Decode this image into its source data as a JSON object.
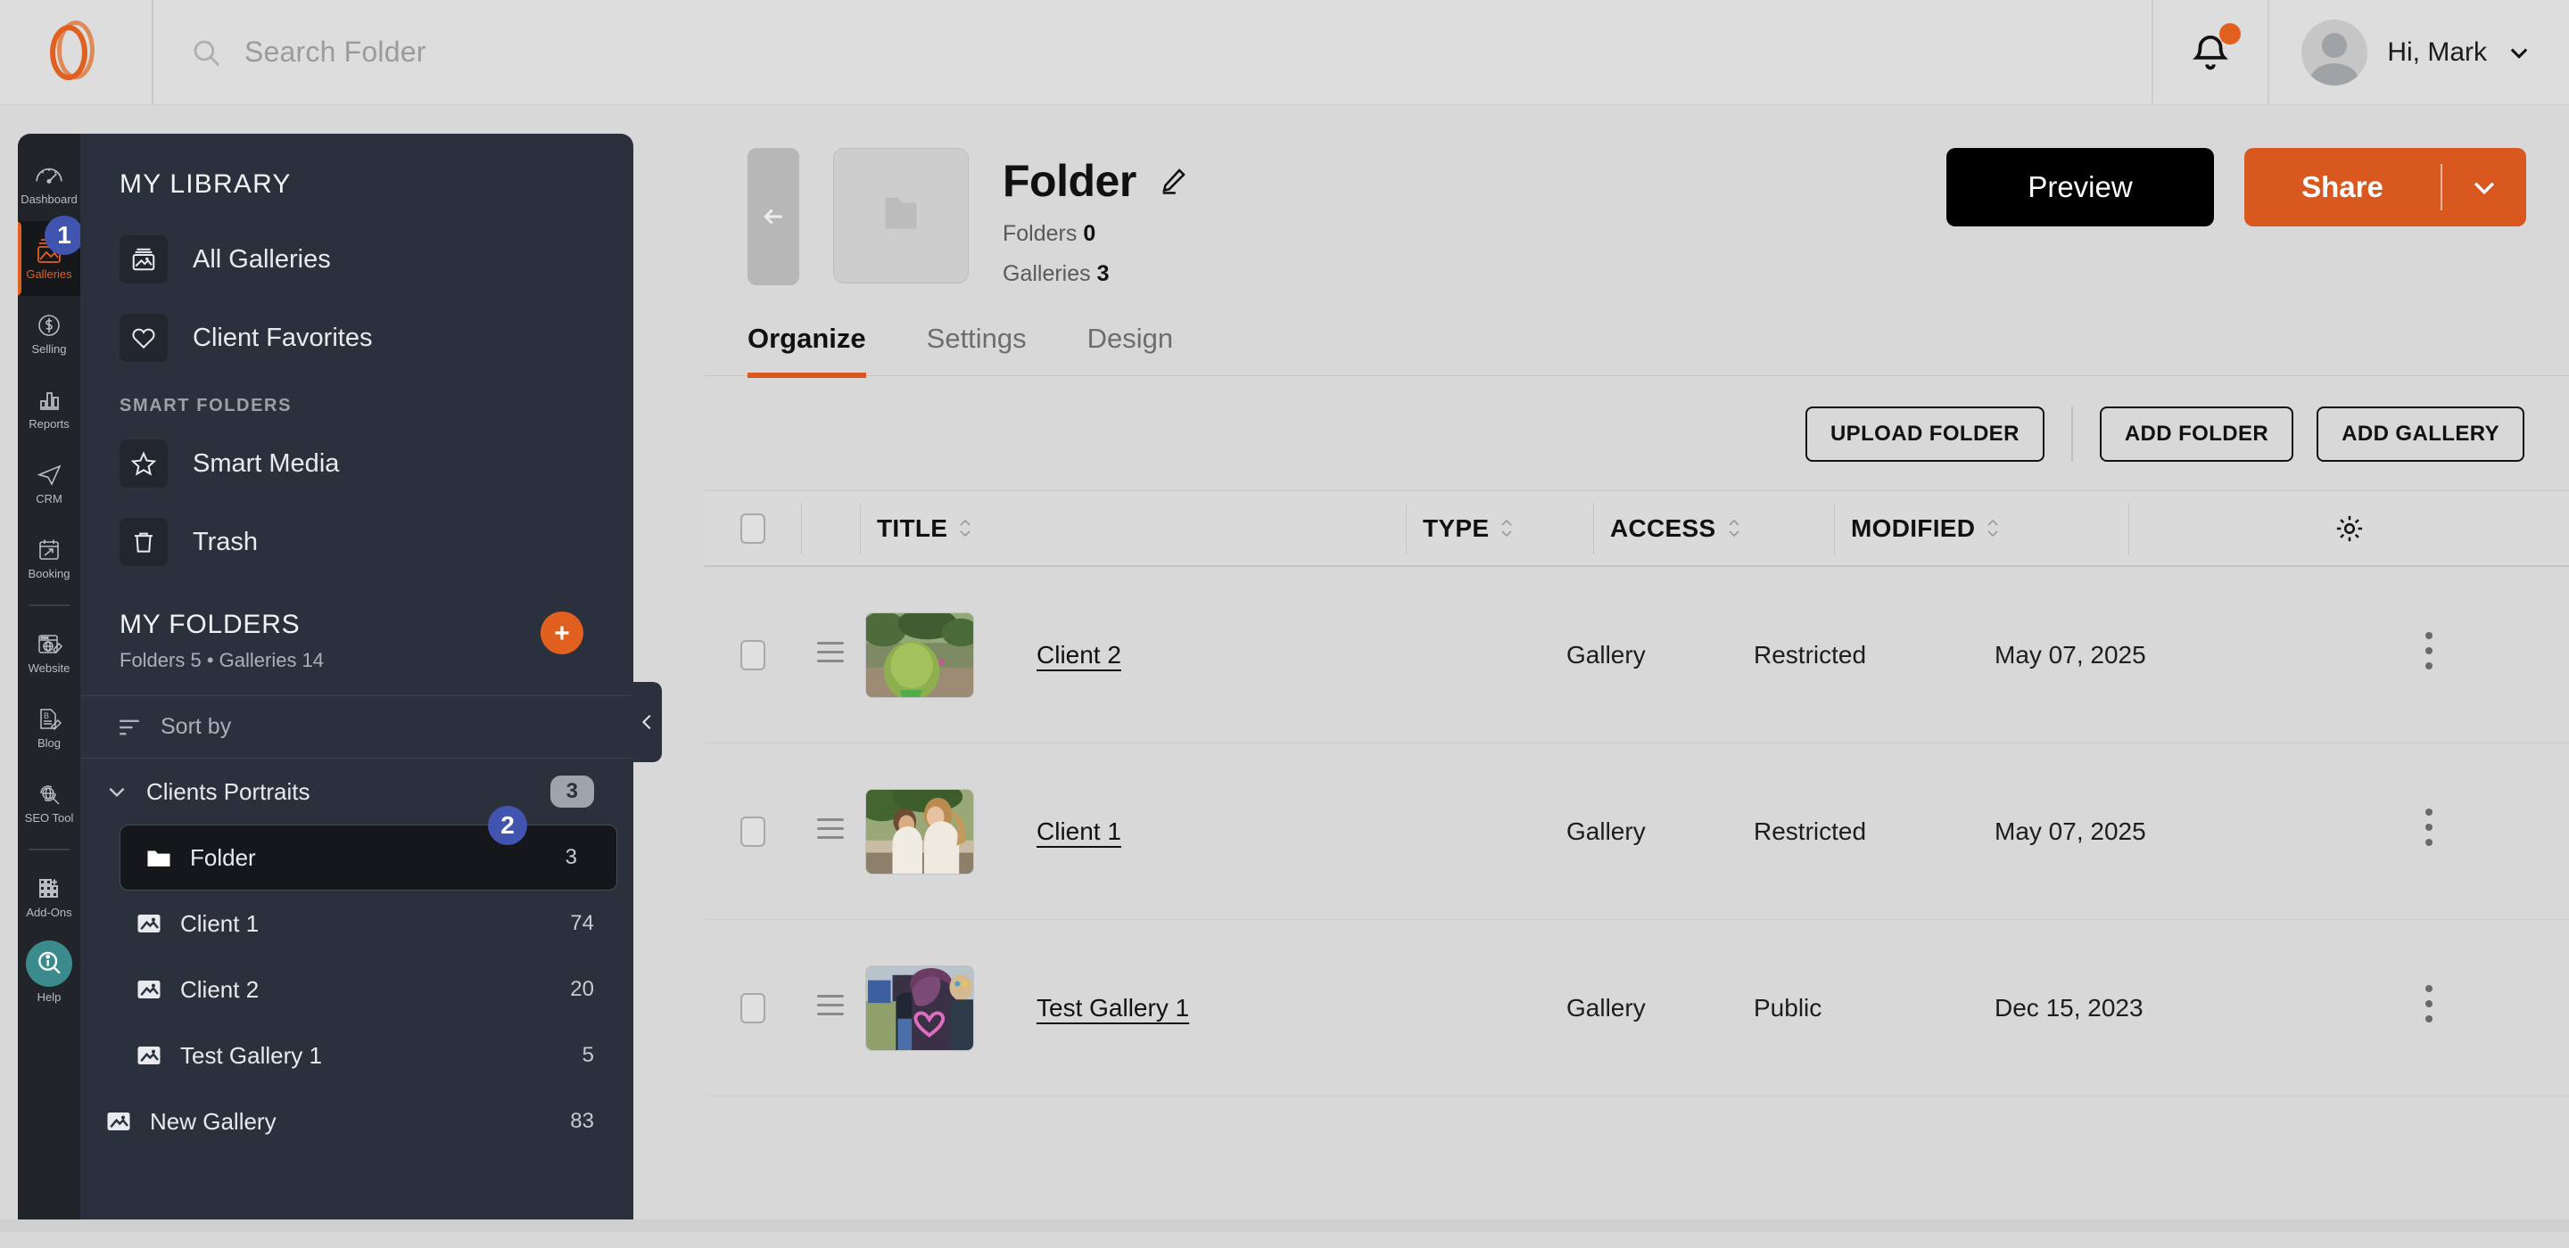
{
  "topbar": {
    "logo_name": "brand-logo",
    "search_placeholder": "Search Folder",
    "search_value": "",
    "greeting": "Hi, Mark",
    "accent_color": "#e2601f"
  },
  "rail": {
    "items": [
      {
        "label": "Dashboard",
        "icon": "speedometer-icon",
        "active": false
      },
      {
        "label": "Galleries",
        "icon": "image-stack-icon",
        "active": true,
        "badge": "1"
      },
      {
        "label": "Selling",
        "icon": "dollar-circle-icon",
        "active": false
      },
      {
        "label": "Reports",
        "icon": "bar-chart-icon",
        "active": false
      },
      {
        "label": "CRM",
        "icon": "paper-plane-icon",
        "active": false
      },
      {
        "label": "Booking",
        "icon": "calendar-arrow-icon",
        "active": false
      },
      {
        "label": "Website",
        "icon": "browser-globe-pencil-icon",
        "active": false
      },
      {
        "label": "Blog",
        "icon": "document-pencil-icon",
        "active": false
      },
      {
        "label": "SEO Tool",
        "icon": "globe-refresh-icon",
        "active": false
      },
      {
        "label": "Add-Ons",
        "icon": "grid-plus-icon",
        "active": false
      },
      {
        "label": "Help",
        "icon": "info-magnifier-icon",
        "active": false
      }
    ]
  },
  "library": {
    "title": "MY LIBRARY",
    "items": [
      {
        "label": "All Galleries",
        "icon": "gallery-icon"
      },
      {
        "label": "Client Favorites",
        "icon": "heart-icon"
      }
    ],
    "smart_folders_label": "SMART FOLDERS",
    "smart_items": [
      {
        "label": "Smart Media",
        "icon": "star-icon"
      },
      {
        "label": "Trash",
        "icon": "trash-icon"
      }
    ]
  },
  "folders_panel": {
    "title": "MY FOLDERS",
    "meta": "Folders 5 • Galleries 14",
    "add_button": "add-folder-plus",
    "sort_label": "Sort by",
    "tree": [
      {
        "label": "Clients Portraits",
        "count": "3",
        "type": "group",
        "expanded": true,
        "selected": false,
        "icon": "chevron-down-icon"
      },
      {
        "label": "Folder",
        "count": "3",
        "type": "folder",
        "selected": true,
        "icon": "folder-icon",
        "badge": "2"
      },
      {
        "label": "Client 1",
        "count": "74",
        "type": "gallery",
        "selected": false,
        "icon": "image-icon"
      },
      {
        "label": "Client 2",
        "count": "20",
        "type": "gallery",
        "selected": false,
        "icon": "image-icon"
      },
      {
        "label": "Test Gallery 1",
        "count": "5",
        "type": "gallery",
        "selected": false,
        "icon": "image-icon"
      },
      {
        "label": "New Gallery",
        "count": "83",
        "type": "gallery-root",
        "selected": false,
        "icon": "image-icon"
      }
    ]
  },
  "main": {
    "back_button": "back-arrow",
    "folder_icon": "folder-thumbnail-icon",
    "title": "Folder",
    "edit_icon": "pencil-icon",
    "stats": [
      {
        "label": "Folders",
        "value": "0"
      },
      {
        "label": "Galleries",
        "value": "3"
      }
    ],
    "preview_label": "Preview",
    "share_label": "Share",
    "share_caret": "chevron-down-icon",
    "tabs": [
      {
        "label": "Organize",
        "active": true
      },
      {
        "label": "Settings",
        "active": false
      },
      {
        "label": "Design",
        "active": false
      }
    ],
    "toolbar": {
      "upload_folder": "UPLOAD FOLDER",
      "add_folder": "ADD FOLDER",
      "add_gallery": "ADD GALLERY"
    },
    "table": {
      "columns": [
        "TITLE",
        "TYPE",
        "ACCESS",
        "MODIFIED"
      ],
      "settings_icon": "gear-icon",
      "rows": [
        {
          "title": "Client 2",
          "type": "Gallery",
          "access": "Restricted",
          "modified": "May 07, 2025",
          "thumb": "green-foliage-festival-photo"
        },
        {
          "title": "Client 1",
          "type": "Gallery",
          "access": "Restricted",
          "modified": "May 07, 2025",
          "thumb": "two-brides-embrace-photo"
        },
        {
          "title": "Test Gallery 1",
          "type": "Gallery",
          "access": "Public",
          "modified": "Dec 15, 2023",
          "thumb": "festival-heart-jacket-photo"
        }
      ]
    }
  }
}
